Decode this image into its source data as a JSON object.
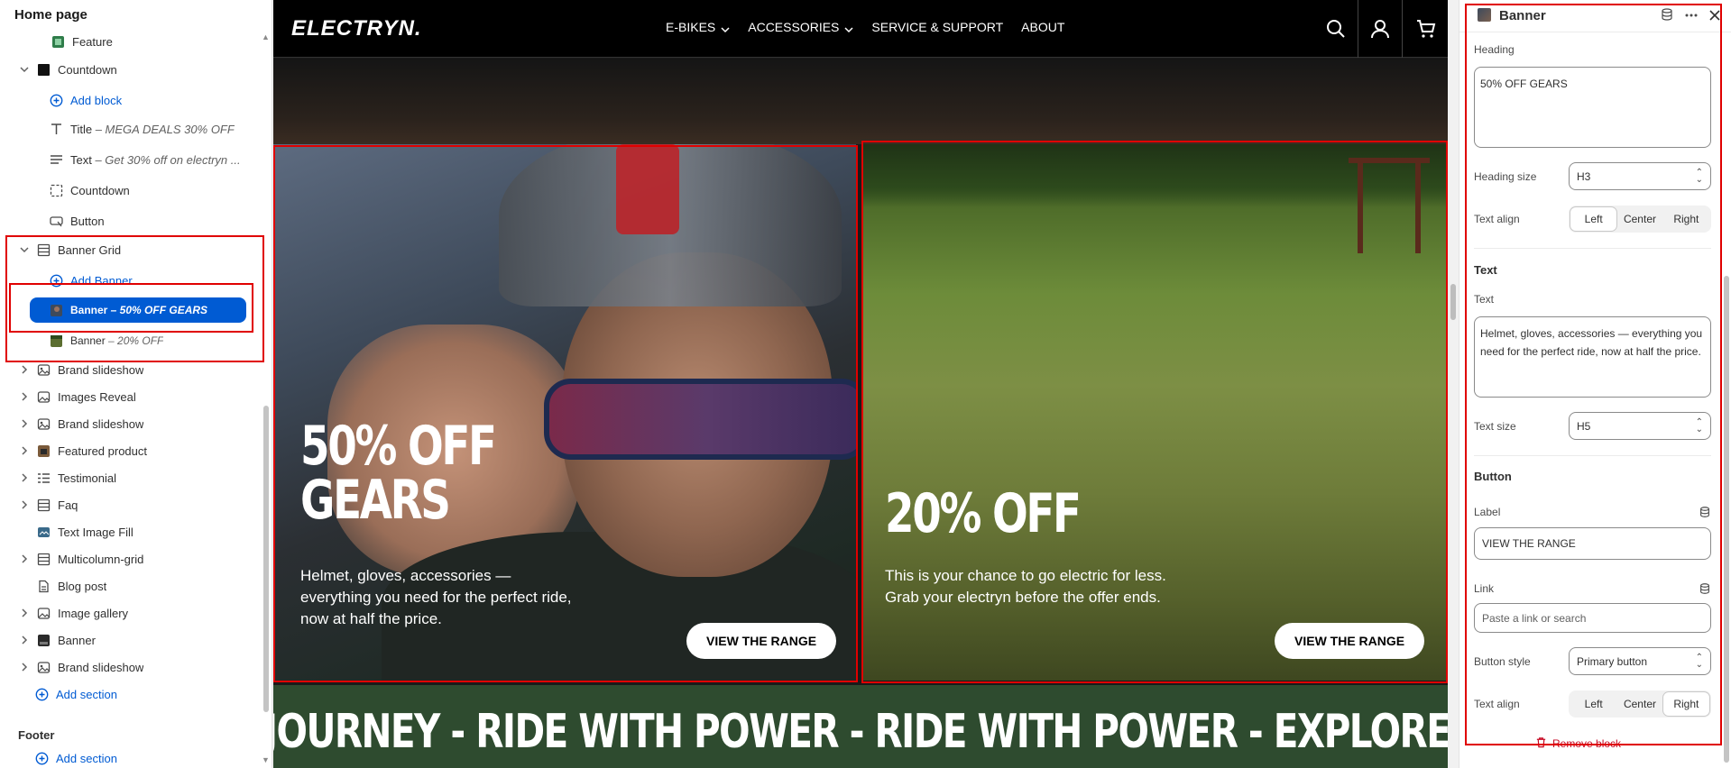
{
  "sidebar": {
    "title": "Home page",
    "items": [
      {
        "label": "Feature",
        "sub": "",
        "icon": "feature-icon"
      },
      {
        "label": "Countdown",
        "sub": "",
        "icon": "section-icon"
      },
      {
        "label": "Add block",
        "sub": "",
        "icon": "add-circle-icon"
      },
      {
        "label": "Title",
        "sub": " – MEGA DEALS 30% OFF",
        "icon": "text-icon"
      },
      {
        "label": "Text",
        "sub": " – Get 30% off on electryn ...",
        "icon": "paragraph-icon"
      },
      {
        "label": "Countdown",
        "sub": "",
        "icon": "countdown-icon"
      },
      {
        "label": "Button",
        "sub": "",
        "icon": "button-icon"
      },
      {
        "label": "Banner Grid",
        "sub": "",
        "icon": "grid-icon"
      },
      {
        "label": "Add Banner",
        "sub": "",
        "icon": "add-circle-icon"
      },
      {
        "label": "Banner",
        "sub": " – 50% OFF GEARS",
        "icon": "image-thumb-icon"
      },
      {
        "label": "Banner",
        "sub": " – 20% OFF",
        "icon": "image-thumb-icon"
      },
      {
        "label": "Brand slideshow",
        "sub": "",
        "icon": "slideshow-icon"
      },
      {
        "label": "Images Reveal",
        "sub": "",
        "icon": "image-icon"
      },
      {
        "label": "Brand slideshow",
        "sub": "",
        "icon": "slideshow-icon"
      },
      {
        "label": "Featured product",
        "sub": "",
        "icon": "product-icon"
      },
      {
        "label": "Testimonial",
        "sub": "",
        "icon": "list-icon"
      },
      {
        "label": "Faq",
        "sub": "",
        "icon": "grid-icon"
      },
      {
        "label": "Text Image Fill",
        "sub": "",
        "icon": "image-text-icon"
      },
      {
        "label": "Multicolumn-grid",
        "sub": "",
        "icon": "grid-icon"
      },
      {
        "label": "Blog post",
        "sub": "",
        "icon": "blog-icon"
      },
      {
        "label": "Image gallery",
        "sub": "",
        "icon": "image-icon"
      },
      {
        "label": "Banner",
        "sub": "",
        "icon": "banner-icon"
      },
      {
        "label": "Brand slideshow",
        "sub": "",
        "icon": "slideshow-icon"
      },
      {
        "label": "Add section",
        "sub": "",
        "icon": "add-circle-icon"
      }
    ],
    "footer_label": "Footer",
    "footer_add": "Add section"
  },
  "store": {
    "logo": "ELECTRYN.",
    "menu": [
      {
        "label": "E-BIKES",
        "dropdown": true
      },
      {
        "label": "ACCESSORIES",
        "dropdown": true
      },
      {
        "label": "SERVICE & SUPPORT",
        "dropdown": false
      },
      {
        "label": "ABOUT",
        "dropdown": false
      }
    ],
    "banner1": {
      "title_line1": "50% OFF",
      "title_line2": "GEARS",
      "text": "Helmet, gloves, accessories — everything you need for the perfect ride, now at half the price.",
      "button": "VIEW THE RANGE"
    },
    "banner2": {
      "title": "20% OFF",
      "text": "This is your chance to go electric for less. Grab your electryn before the offer ends.",
      "button": "VIEW THE RANGE"
    },
    "marquee": "JOURNEY  -  RIDE WITH POWER  -  RIDE WITH POWER  -  EXPLORE WITHOUT LIMITS"
  },
  "panel": {
    "title": "Banner",
    "heading_label": "Heading",
    "heading_value": "50% OFF GEARS",
    "heading_size_label": "Heading size",
    "heading_size_value": "H3",
    "text_align_label": "Text align",
    "align_options": [
      "Left",
      "Center",
      "Right"
    ],
    "heading_align_selected": "Left",
    "text_section": "Text",
    "text_label": "Text",
    "text_value": "Helmet, gloves, accessories — everything you need for the perfect ride, now at half the price.",
    "text_size_label": "Text size",
    "text_size_value": "H5",
    "button_section": "Button",
    "label_label": "Label",
    "label_value": "VIEW THE RANGE",
    "link_label": "Link",
    "link_placeholder": "Paste a link or search",
    "button_style_label": "Button style",
    "button_style_value": "Primary button",
    "button_align_label": "Text align",
    "button_align_selected": "Right",
    "remove_label": "Remove block"
  },
  "colors": {
    "accent": "#005bd3",
    "highlight": "#e00000",
    "marquee_bg": "#2e4b2f",
    "danger": "#c70a24"
  }
}
